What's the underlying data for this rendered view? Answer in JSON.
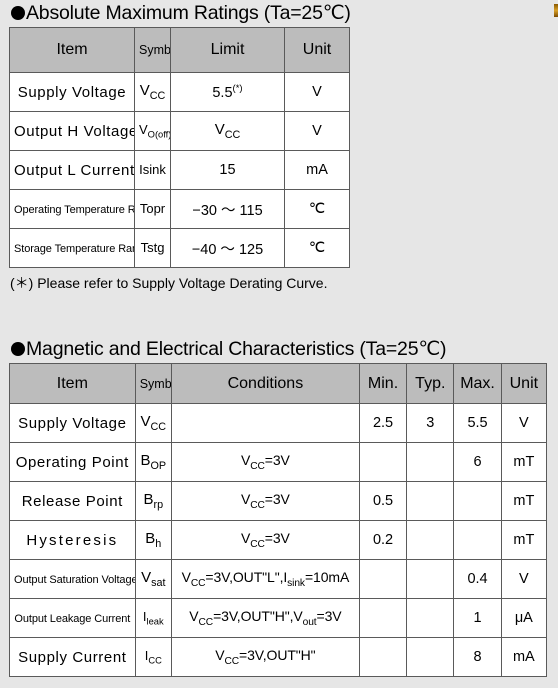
{
  "page": {
    "background_color": "#e6e6e6",
    "header_fill_color": "#bcbcbc",
    "border_color": "#3c3c3c"
  },
  "sections": [
    {
      "id": "absolute-maximum-ratings",
      "bullet": "filled-circle-bullet",
      "heading": "Absolute Maximum Ratings (Ta=25℃)",
      "heading_main": "Absolute Maximum Ratings",
      "heading_condition": "(Ta=25℃)",
      "columns": [
        "Item",
        "Symbol",
        "Limit",
        "Unit"
      ],
      "rows": [
        {
          "item": "Supply  Voltage",
          "symbol": "V",
          "symbol_sub": "CC",
          "limit": "5.5",
          "limit_sup": "(*)",
          "unit": "V"
        },
        {
          "item": "Output H Voltage",
          "symbol": "V",
          "symbol_sub": "O(off)",
          "limit": "V",
          "limit_sub": "CC",
          "unit": "V"
        },
        {
          "item": "Output L Current",
          "symbol": "Isink",
          "symbol_sub": "",
          "limit": "15",
          "unit": "mA"
        },
        {
          "item": "Operating  Temperature  Range",
          "symbol": "Topr",
          "symbol_sub": "",
          "limit": "−30 ～ 115",
          "unit": "℃"
        },
        {
          "item": "Storage Temperature Range",
          "symbol": "Tstg",
          "symbol_sub": "",
          "limit": "−40 ～ 125",
          "unit": "℃"
        }
      ],
      "footnote": "(＊) Please refer to Supply Voltage Derating Curve."
    },
    {
      "id": "magnetic-and-electrical-characteristics",
      "bullet": "filled-circle-bullet",
      "heading": "Magnetic and Electrical Characteristics (Ta=25℃)",
      "heading_main": "Magnetic and Electrical Characteristics",
      "heading_condition": "(Ta=25℃)",
      "columns": [
        "Item",
        "Symbol",
        "Conditions",
        "Min.",
        "Typ.",
        "Max.",
        "Unit"
      ],
      "rows": [
        {
          "item": "Supply  Voltage",
          "symbol": "V",
          "symbol_sub": "CC",
          "conditions": "",
          "cond_prefix": "",
          "min": "2.5",
          "typ": "3",
          "max": "5.5",
          "unit": "V"
        },
        {
          "item": "Operating  Point",
          "symbol": "B",
          "symbol_sub": "OP",
          "conditions": "V<sub>CC</sub>=3V",
          "cond_prefix": "V",
          "cond_sub": "CC",
          "cond_rest": "=3V",
          "min": "",
          "typ": "",
          "max": "6",
          "unit": "mT"
        },
        {
          "item": "Release  Point",
          "symbol": "B",
          "symbol_sub": "rp",
          "cond_prefix": "V",
          "cond_sub": "CC",
          "cond_rest": "=3V",
          "min": "0.5",
          "typ": "",
          "max": "",
          "unit": "mT"
        },
        {
          "item": "Hysteresis",
          "symbol": "B",
          "symbol_sub": "h",
          "cond_prefix": "V",
          "cond_sub": "CC",
          "cond_rest": "=3V",
          "min": "0.2",
          "typ": "",
          "max": "",
          "unit": "mT"
        },
        {
          "item": "Output Saturation Voltage",
          "symbol": "V",
          "symbol_sub": "sat",
          "cond_prefix": "V",
          "cond_sub": "CC",
          "cond_rest": "=3V,OUT\"L\",",
          "cond_prefix2": "I",
          "cond_sub2": "sink",
          "cond_rest2": "=10mA",
          "min": "",
          "typ": "",
          "max": "0.4",
          "unit": "V"
        },
        {
          "item": "Output Leakage Current",
          "symbol": "I",
          "symbol_sub": "leak",
          "cond_prefix": "V",
          "cond_sub": "CC",
          "cond_rest": "=3V,OUT\"H\",",
          "cond_prefix2": "V",
          "cond_sub2": "out",
          "cond_rest2": "=3V",
          "min": "",
          "typ": "",
          "max": "1",
          "unit": "μA"
        },
        {
          "item": "Supply  Current",
          "symbol": "I",
          "symbol_sub": "CC",
          "cond_prefix": "V",
          "cond_sub": "CC",
          "cond_rest": "=3V,OUT\"H\"",
          "min": "",
          "typ": "",
          "max": "8",
          "unit": "mA"
        }
      ]
    }
  ]
}
